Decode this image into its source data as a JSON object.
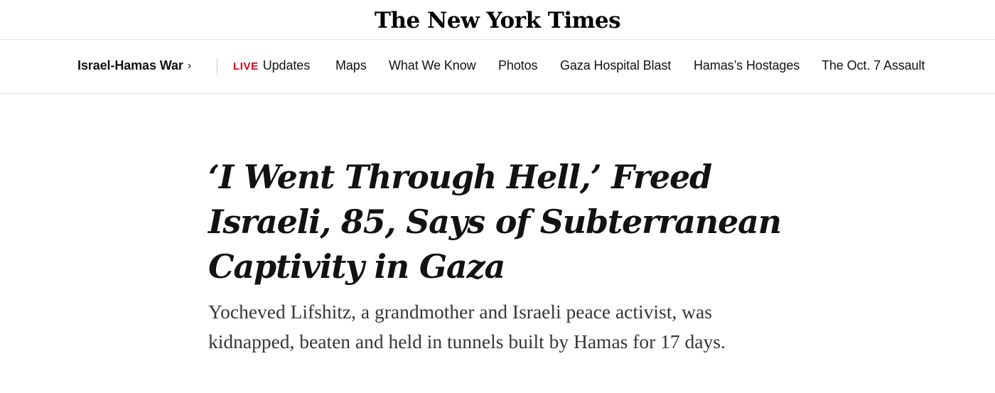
{
  "masthead": {
    "logo_text": "The New York Times"
  },
  "subnav": {
    "section_label": "Israel-Hamas War",
    "section_chevron": "›",
    "live_tag": "LIVE",
    "items": [
      {
        "label": "Updates"
      },
      {
        "label": "Maps"
      },
      {
        "label": "What We Know"
      },
      {
        "label": "Photos"
      },
      {
        "label": "Gaza Hospital Blast"
      },
      {
        "label": "Hamas’s Hostages"
      },
      {
        "label": "The Oct. 7 Assault"
      }
    ],
    "accent_color": "#d0021b"
  },
  "article": {
    "headline": "‘I Went Through Hell,’ Freed Israeli, 85, Says of Subterranean Captivity in Gaza",
    "summary": "Yocheved Lifshitz, a grandmother and Israeli peace activist, was kidnapped, beaten and held in tunnels built by Hamas for 17 days."
  }
}
